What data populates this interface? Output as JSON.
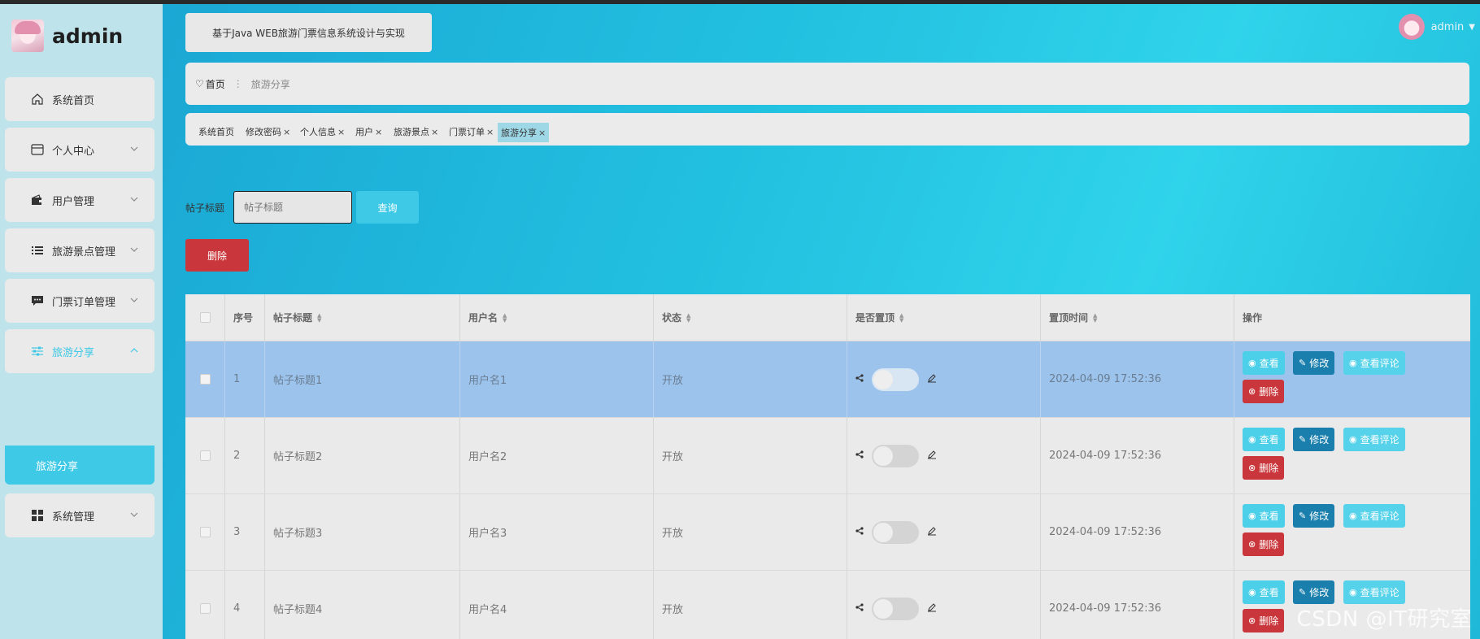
{
  "brand": {
    "name": "admin"
  },
  "sidebar": {
    "items": [
      {
        "label": "系统首页",
        "icon": "home-icon",
        "has_children": false
      },
      {
        "label": "个人中心",
        "icon": "card-icon",
        "has_children": true
      },
      {
        "label": "用户管理",
        "icon": "wallet-icon",
        "has_children": true
      },
      {
        "label": "旅游景点管理",
        "icon": "list-icon",
        "has_children": true
      },
      {
        "label": "门票订单管理",
        "icon": "chat-icon",
        "has_children": true
      },
      {
        "label": "旅游分享",
        "icon": "sliders-icon",
        "has_children": true,
        "active": true
      },
      {
        "label": "系统管理",
        "icon": "grid-icon",
        "has_children": true
      }
    ],
    "submenu": {
      "label": "旅游分享"
    }
  },
  "header": {
    "system_title": "基于Java WEB旅游门票信息系统设计与实现",
    "user": "admin"
  },
  "breadcrumb": {
    "home": "首页",
    "current": "旅游分享"
  },
  "tabs": [
    {
      "label": "系统首页",
      "closable": false
    },
    {
      "label": "修改密码",
      "closable": true
    },
    {
      "label": "个人信息",
      "closable": true
    },
    {
      "label": "用户",
      "closable": true
    },
    {
      "label": "旅游景点",
      "closable": true
    },
    {
      "label": "门票订单",
      "closable": true
    },
    {
      "label": "旅游分享",
      "closable": true,
      "active": true
    }
  ],
  "search": {
    "label": "帖子标题",
    "placeholder": "帖子标题",
    "button": "查询"
  },
  "toolbar": {
    "delete_label": "删除"
  },
  "table": {
    "columns": [
      "序号",
      "帖子标题",
      "用户名",
      "状态",
      "是否置顶",
      "置顶时间",
      "操作"
    ],
    "rows": [
      {
        "index": "1",
        "title": "帖子标题1",
        "username": "用户名1",
        "status": "开放",
        "pinned": false,
        "pin_time": "2024-04-09 17:52:36",
        "selected": true
      },
      {
        "index": "2",
        "title": "帖子标题2",
        "username": "用户名2",
        "status": "开放",
        "pinned": false,
        "pin_time": "2024-04-09 17:52:36",
        "selected": false
      },
      {
        "index": "3",
        "title": "帖子标题3",
        "username": "用户名3",
        "status": "开放",
        "pinned": false,
        "pin_time": "2024-04-09 17:52:36",
        "selected": false
      },
      {
        "index": "4",
        "title": "帖子标题4",
        "username": "用户名4",
        "status": "开放",
        "pinned": false,
        "pin_time": "2024-04-09 17:52:36",
        "selected": false
      }
    ],
    "actions": {
      "view": "查看",
      "edit": "修改",
      "comments": "查看评论",
      "delete": "删除"
    }
  },
  "watermark": "CSDN @IT研究室",
  "colors": {
    "accent": "#3ec9e6",
    "danger": "#c9363b",
    "edit": "#1a7fad",
    "selected_row": "#9cc3ec"
  }
}
